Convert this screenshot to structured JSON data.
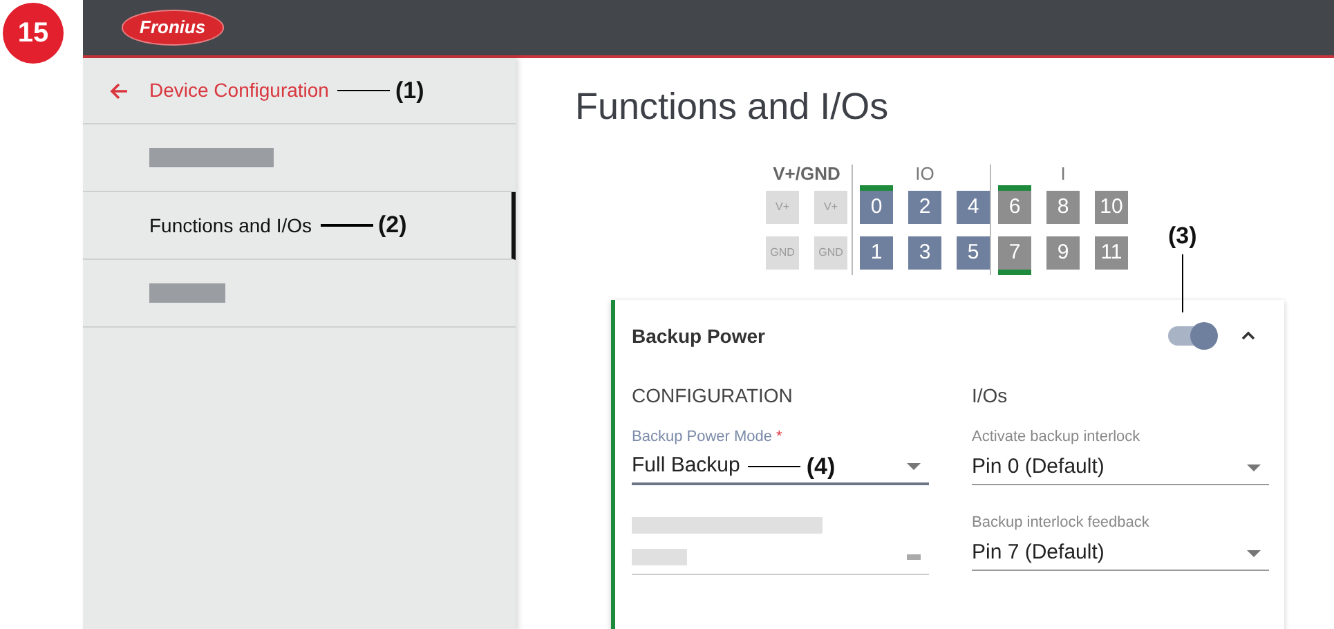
{
  "step_badge": "15",
  "header": {
    "logo": "Fronius"
  },
  "sidebar": {
    "back_link": "Device Configuration",
    "items": [
      {
        "kind": "redacted",
        "selected": false
      },
      {
        "kind": "text",
        "label": "Functions and I/Os",
        "selected": true
      },
      {
        "kind": "redacted",
        "selected": false
      }
    ]
  },
  "page_title": "Functions and I/Os",
  "pin_groups": [
    {
      "title": "V+/GND",
      "kind": "power",
      "columns": [
        [
          {
            "label": "V+",
            "bar_top": false,
            "bar_bottom": false
          },
          {
            "label": "GND",
            "bar_top": false,
            "bar_bottom": false
          }
        ],
        [
          {
            "label": "V+",
            "bar_top": false,
            "bar_bottom": false
          },
          {
            "label": "GND",
            "bar_top": false,
            "bar_bottom": false
          }
        ]
      ]
    },
    {
      "title": "IO",
      "kind": "io",
      "columns": [
        [
          {
            "label": "0",
            "bar_top": true,
            "bar_bottom": false
          },
          {
            "label": "1",
            "bar_top": false,
            "bar_bottom": false
          }
        ],
        [
          {
            "label": "2",
            "bar_top": false,
            "bar_bottom": false
          },
          {
            "label": "3",
            "bar_top": false,
            "bar_bottom": false
          }
        ],
        [
          {
            "label": "4",
            "bar_top": false,
            "bar_bottom": false
          },
          {
            "label": "5",
            "bar_top": false,
            "bar_bottom": false
          }
        ]
      ]
    },
    {
      "title": "I",
      "kind": "input",
      "columns": [
        [
          {
            "label": "6",
            "bar_top": true,
            "bar_bottom": false
          },
          {
            "label": "7",
            "bar_top": false,
            "bar_bottom": true
          }
        ],
        [
          {
            "label": "8",
            "bar_top": false,
            "bar_bottom": false
          },
          {
            "label": "9",
            "bar_top": false,
            "bar_bottom": false
          }
        ],
        [
          {
            "label": "10",
            "bar_top": false,
            "bar_bottom": false
          },
          {
            "label": "11",
            "bar_top": false,
            "bar_bottom": false
          }
        ]
      ]
    }
  ],
  "card": {
    "title": "Backup Power",
    "enabled": true,
    "expanded": true,
    "sections": [
      {
        "heading": "CONFIGURATION",
        "fields": [
          {
            "kind": "select",
            "label": "Backup Power Mode",
            "required_mark": "*",
            "value": "Full Backup",
            "focused": true
          },
          {
            "kind": "redacted"
          }
        ]
      },
      {
        "heading": "I/Os",
        "fields": [
          {
            "kind": "select",
            "label": "Activate backup interlock",
            "value": "Pin 0 (Default)",
            "focused": false
          },
          {
            "kind": "select",
            "label": "Backup interlock feedback",
            "value": "Pin 7 (Default)",
            "focused": false
          }
        ]
      }
    ]
  },
  "callouts": [
    "(1)",
    "(2)",
    "(3)",
    "(4)"
  ]
}
